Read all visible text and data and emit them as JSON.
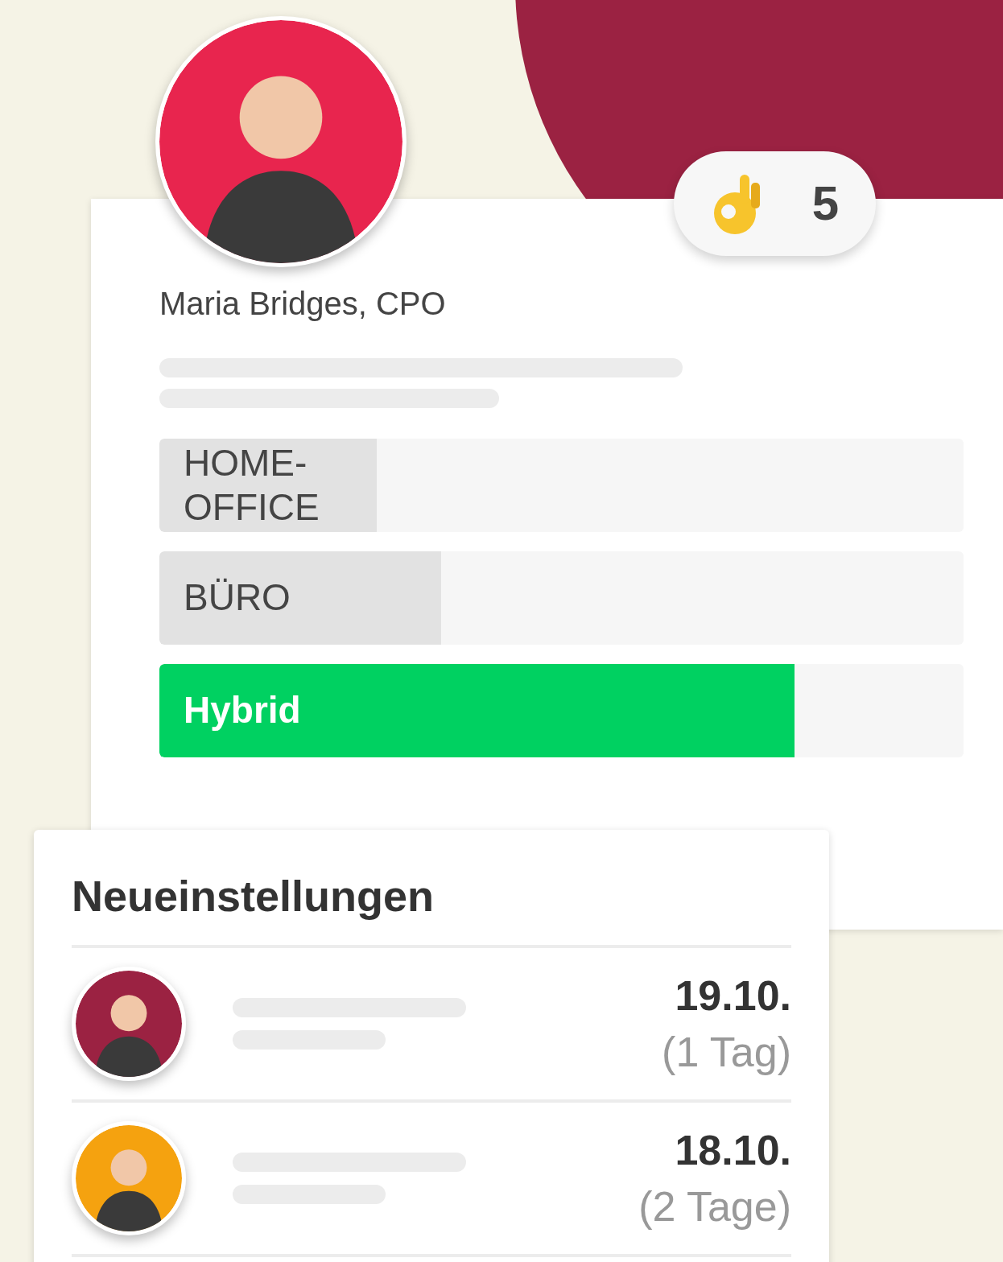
{
  "profile": {
    "name": "Maria Bridges, CPO",
    "reaction": {
      "count": "5"
    }
  },
  "poll": {
    "options": [
      {
        "label": "HOME-\nOFFICE",
        "level": 0.27,
        "selected": false
      },
      {
        "label": "BÜRO",
        "level": 0.35,
        "selected": false
      },
      {
        "label": "Hybrid",
        "level": 0.79,
        "selected": true
      }
    ]
  },
  "new_hires": {
    "title": "Neueinstellungen",
    "rows": [
      {
        "date": "19.10.",
        "duration": "(1 Tag)",
        "color": "#9b2242"
      },
      {
        "date": "18.10.",
        "duration": "(2 Tage)",
        "color": "#f5a20f"
      }
    ]
  }
}
